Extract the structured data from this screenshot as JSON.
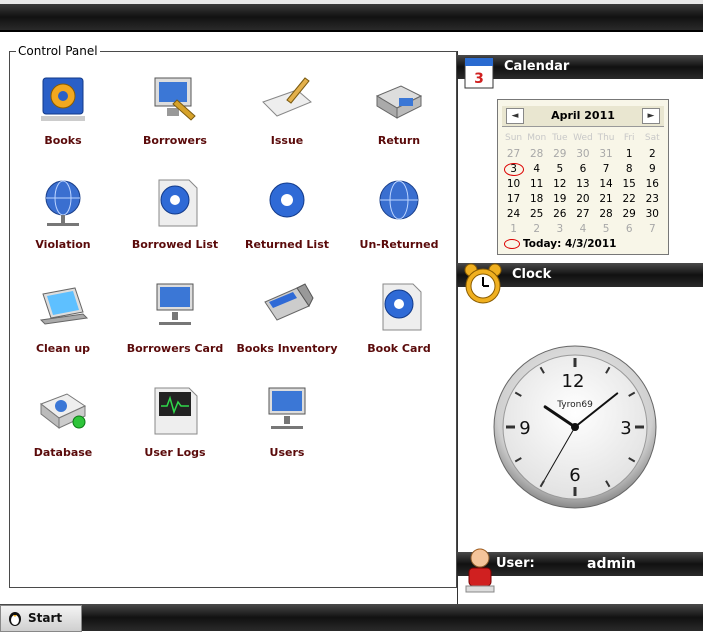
{
  "control_panel": {
    "title": "Control Panel",
    "items": [
      {
        "label": "Books"
      },
      {
        "label": "Borrowers"
      },
      {
        "label": "Issue"
      },
      {
        "label": "Return"
      },
      {
        "label": "Violation"
      },
      {
        "label": "Borrowed List"
      },
      {
        "label": "Returned List"
      },
      {
        "label": "Un-Returned"
      },
      {
        "label": "Clean up"
      },
      {
        "label": "Borrowers  Card"
      },
      {
        "label": "Books Inventory"
      },
      {
        "label": "Book Card"
      },
      {
        "label": "Database"
      },
      {
        "label": "User Logs"
      },
      {
        "label": "Users"
      }
    ]
  },
  "calendar": {
    "title": "Calendar",
    "icon_day": "3",
    "month": "April 2011",
    "prev": "◄",
    "next": "►",
    "dows": [
      "Sun",
      "Mon",
      "Tue",
      "Wed",
      "Thu",
      "Fri",
      "Sat"
    ],
    "weeks": [
      [
        "27",
        "28",
        "29",
        "30",
        "31",
        "1",
        "2"
      ],
      [
        "3",
        "4",
        "5",
        "6",
        "7",
        "8",
        "9"
      ],
      [
        "10",
        "11",
        "12",
        "13",
        "14",
        "15",
        "16"
      ],
      [
        "17",
        "18",
        "19",
        "20",
        "21",
        "22",
        "23"
      ],
      [
        "24",
        "25",
        "26",
        "27",
        "28",
        "29",
        "30"
      ],
      [
        "1",
        "2",
        "3",
        "4",
        "5",
        "6",
        "7"
      ]
    ],
    "today_label": "Today: 4/3/2011"
  },
  "clock": {
    "title": "Clock",
    "brand": "Tyron69",
    "numerals": [
      "12",
      "3",
      "6",
      "9"
    ],
    "time": {
      "hour": 10,
      "minute": 8,
      "second": 35
    }
  },
  "user": {
    "label": "User:",
    "name": "admin"
  },
  "taskbar": {
    "start_label": "Start"
  }
}
